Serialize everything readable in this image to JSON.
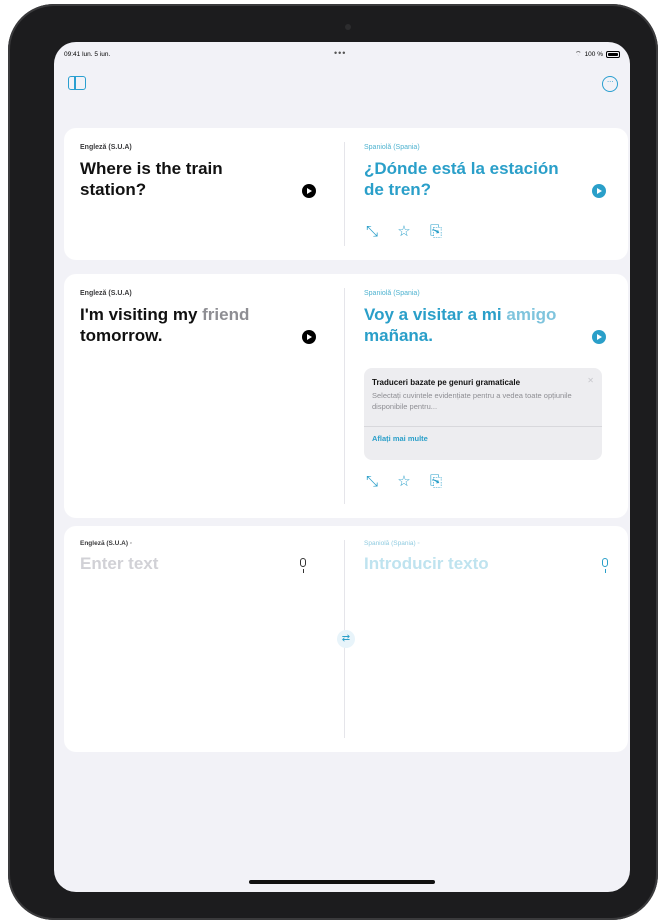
{
  "status_bar": {
    "time": "09:41  lun. 5 iun.",
    "dots": "•••",
    "battery": "100 %"
  },
  "cards": [
    {
      "source_lang": "Engleză (S.U.A)",
      "source_text": "Where is the train station?",
      "target_lang": "Spaniolă (Spania)",
      "target_text": "¿Dónde está la estación de tren?"
    },
    {
      "source_lang": "Engleză (S.U.A)",
      "source_text_a": "I'm visiting my ",
      "source_text_b": "friend",
      "source_text_c": " tomorrow.",
      "target_lang": "Spaniolă (Spania)",
      "target_text_a": "Voy a visitar a mi ",
      "target_text_b": "amigo",
      "target_text_c": " mañana.",
      "info": {
        "title": "Traduceri bazate pe genuri gramaticale",
        "body": "Selectați cuvintele evidențiate pentru a vedea toate opțiunile disponibile pentru...",
        "link": "Aflați mai multe"
      }
    }
  ],
  "input": {
    "source_lang": "Engleză (S.U.A) ◦",
    "source_placeholder": "Enter text",
    "target_lang": "Spaniolă (Spania) ◦",
    "target_placeholder": "Introducir texto"
  },
  "icons": {
    "expand": "⤡",
    "star": "☆",
    "copy": "⎘",
    "swap": "⇄",
    "close": "✕",
    "wifi": "⌔"
  }
}
